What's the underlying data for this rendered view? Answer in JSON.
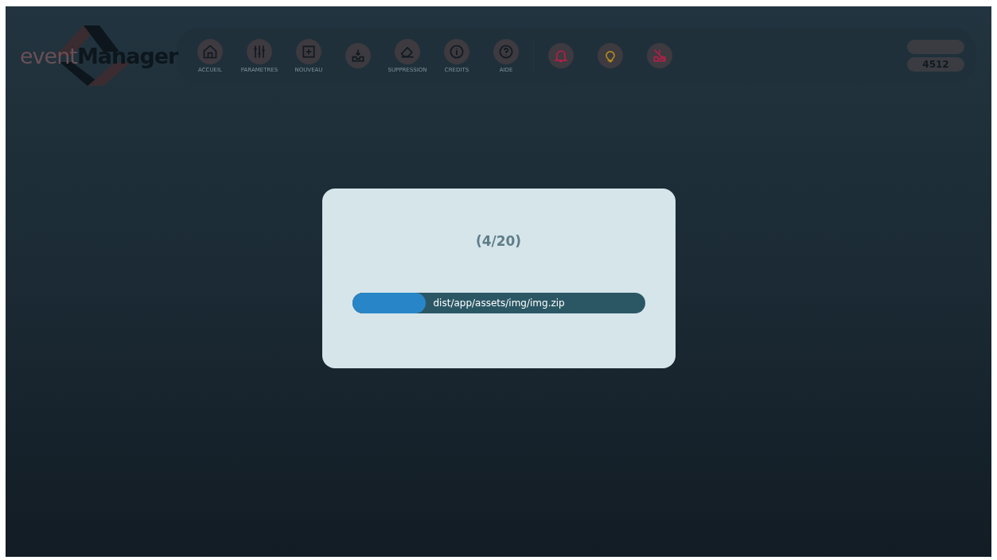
{
  "logo": {
    "prefix": "event",
    "name": "Manager"
  },
  "toolbar": [
    {
      "kind": "home",
      "label": "ACCUEIL"
    },
    {
      "kind": "sliders",
      "label": "PARAMETRES"
    },
    {
      "kind": "plus",
      "label": "NOUVEAU"
    },
    {
      "kind": "inbox"
    },
    {
      "kind": "eraser",
      "label": "SUPPRESSION"
    },
    {
      "kind": "info",
      "label": "CREDITS"
    },
    {
      "kind": "help",
      "label": "AIDE"
    },
    {
      "kind": "bell",
      "color": "#b0204a"
    },
    {
      "kind": "bulb",
      "color": "#b08a20"
    },
    {
      "kind": "inbox-off",
      "color": "#b0204a"
    }
  ],
  "counter": {
    "value": "4512"
  },
  "dialog": {
    "step": "(4/20)",
    "file": "dist/app/assets/img/img.zip",
    "level": 0.25
  }
}
